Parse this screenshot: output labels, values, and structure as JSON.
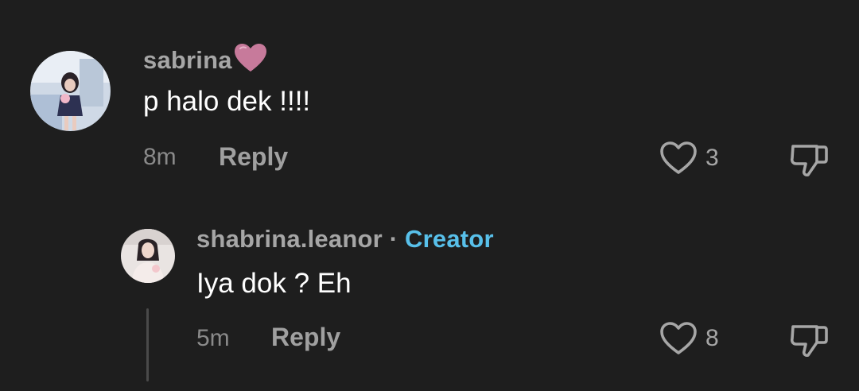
{
  "comments": [
    {
      "username": "sabrina",
      "name_emoji": "heart-emoji",
      "text": "p halo dek !!!!",
      "time": "8m",
      "reply_label": "Reply",
      "likes": "3"
    },
    {
      "username": "shabrina.leanor",
      "separator": "·",
      "badge": "Creator",
      "text": "Iya dok ? Eh",
      "time": "5m",
      "reply_label": "Reply",
      "likes": "8"
    }
  ],
  "colors": {
    "background": "#1e1e1e",
    "creator_badge": "#58c0ea",
    "heart_emoji": "#c77a9b"
  },
  "icons": [
    "heart-outline-icon",
    "thumbs-down-icon"
  ]
}
